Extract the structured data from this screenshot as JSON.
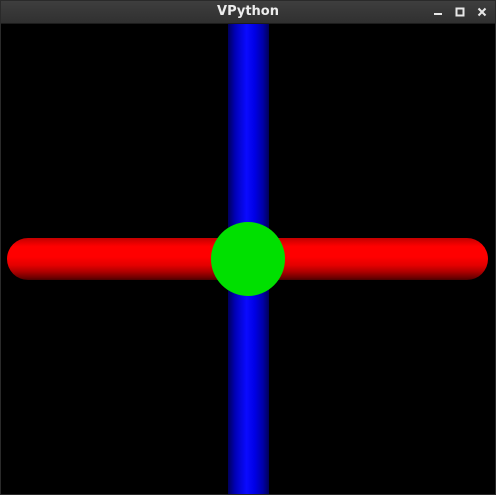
{
  "window": {
    "title": "VPython",
    "controls": [
      {
        "name": "minimize",
        "icon": "minimize-icon"
      },
      {
        "name": "maximize",
        "icon": "maximize-icon"
      },
      {
        "name": "close",
        "icon": "close-icon"
      }
    ]
  },
  "scene": {
    "background_color": "#000000",
    "objects": [
      {
        "type": "cylinder",
        "orientation": "vertical",
        "color": "#0000ff"
      },
      {
        "type": "cylinder",
        "orientation": "horizontal",
        "color": "#ff0000"
      },
      {
        "type": "sphere",
        "color": "#00e000"
      }
    ]
  }
}
